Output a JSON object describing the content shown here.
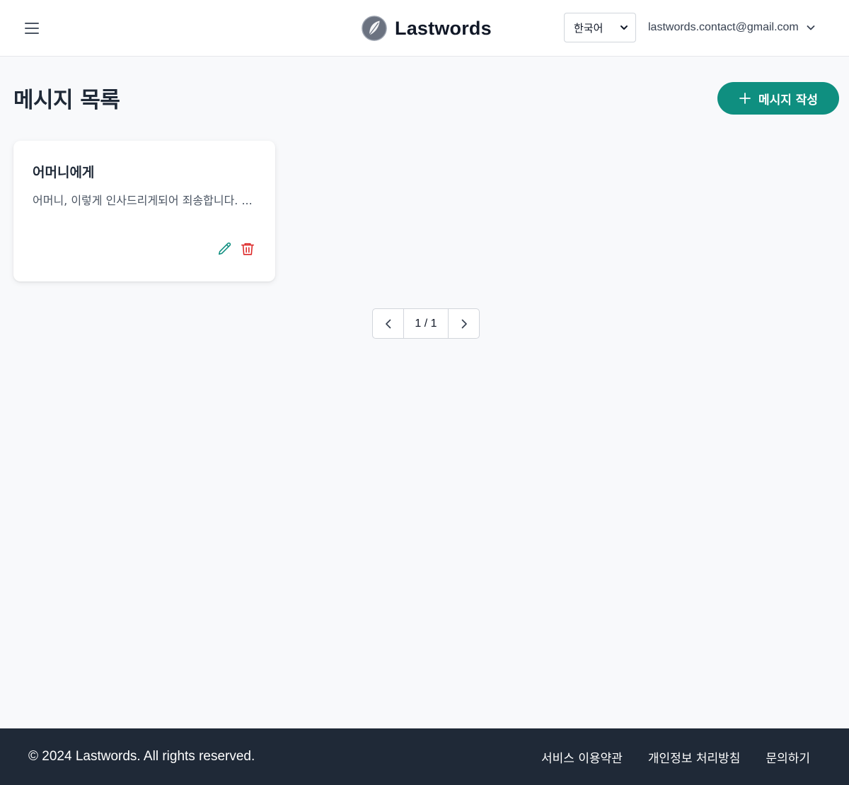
{
  "header": {
    "menu_icon": "hamburger-icon",
    "brand_name": "Lastwords",
    "brand_icon": "feather-logo",
    "language": {
      "selected": "한국어"
    },
    "user_email": "lastwords.contact@gmail.com",
    "user_menu_icon": "chevron-down-icon"
  },
  "page": {
    "title": "메시지 목록",
    "compose_button": "메시지 작성"
  },
  "messages": [
    {
      "title": "어머니에게",
      "preview": "어머니, 이렇게 인사드리게되어 죄송합니다. ..."
    }
  ],
  "pagination": {
    "label": "1 / 1"
  },
  "footer": {
    "copyright": "© 2024 Lastwords. All rights reserved.",
    "links": [
      "서비스 이용약관",
      "개인정보 처리방침",
      "문의하기"
    ]
  },
  "colors": {
    "primary": "#0f8f80",
    "edit": "#0f8f80",
    "delete": "#dc2626",
    "footer_bg": "#1f2937"
  }
}
